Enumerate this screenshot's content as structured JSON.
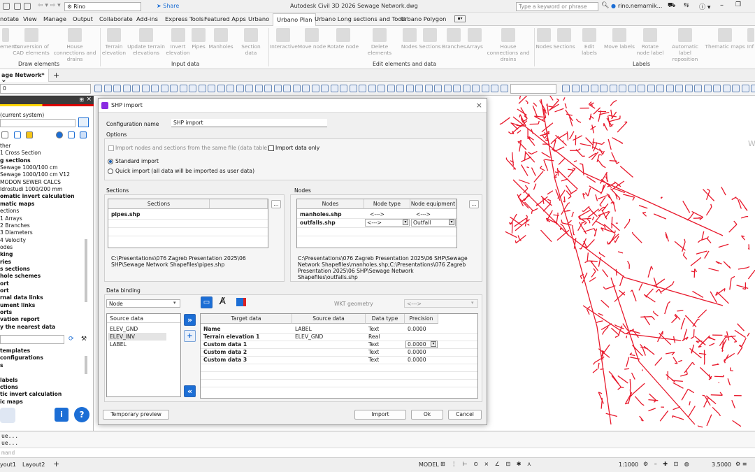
{
  "app": {
    "title": "Autodesk Civil 3D 2026   Sewage Network.dwg",
    "workspace": "Rino",
    "share": "Share",
    "search_placeholder": "Type a keyword or phrase",
    "user": "rino.nemarnik..."
  },
  "ribbon_tabs": [
    "notate",
    "View",
    "Manage",
    "Output",
    "Collaborate",
    "Add-ins",
    "Express Tools",
    "Featured Apps",
    "Urbano",
    "Urbano Plan",
    "Urbano Long sections and Tools",
    "Urbano Polygon"
  ],
  "ribbon": {
    "draw": [
      {
        "label": "ements"
      },
      {
        "label": "Conversion of CAD elements"
      },
      {
        "label": "House connections and drains"
      }
    ],
    "input": [
      {
        "label": "Terrain elevation"
      },
      {
        "label": "Update terrain elevations"
      },
      {
        "label": "Invert elevation"
      },
      {
        "label": "Pipes"
      },
      {
        "label": "Manholes"
      },
      {
        "label": "Section data"
      }
    ],
    "edit": [
      {
        "label": "Interactive"
      },
      {
        "label": "Move node"
      },
      {
        "label": "Rotate node"
      },
      {
        "label": "Delete elements"
      },
      {
        "label": "Nodes"
      },
      {
        "label": "Sections"
      },
      {
        "label": "Branches"
      },
      {
        "label": "Arrays"
      },
      {
        "label": "House connections and drains"
      }
    ],
    "labels": [
      {
        "label": "Nodes"
      },
      {
        "label": "Sections"
      },
      {
        "label": "Edit labels"
      },
      {
        "label": "Move labels"
      },
      {
        "label": "Rotate node label"
      },
      {
        "label": "Automatic label reposition"
      },
      {
        "label": "Thematic maps"
      },
      {
        "label": "Inf"
      }
    ],
    "groups": {
      "draw": "Draw elements",
      "input": "Input data",
      "edit": "Edit elements and data",
      "labels": "Labels"
    }
  },
  "doc_tab": "age Network*",
  "layer_value": "0",
  "left_panel": {
    "header": "(current system)",
    "tree": [
      {
        "t": "ther",
        "b": false
      },
      {
        "t": "1 Cross Section",
        "b": false
      },
      {
        "t": "g sections",
        "b": true
      },
      {
        "t": "Sewage 1000/100 cm",
        "b": false
      },
      {
        "t": "Sewage 1000/100 cm V12",
        "b": false
      },
      {
        "t": "MODON SEWER CALCS",
        "b": false
      },
      {
        "t": "Idrostudi 1000/200 mm",
        "b": false
      },
      {
        "t": "omatic invert calculation",
        "b": true
      },
      {
        "t": "matic maps",
        "b": true
      },
      {
        "t": "ections",
        "b": false
      },
      {
        "t": "1 Arrays",
        "b": false
      },
      {
        "t": "2 Branches",
        "b": false
      },
      {
        "t": "3 Diameters",
        "b": false
      },
      {
        "t": "4 Velocity",
        "b": false
      },
      {
        "t": "odes",
        "b": false
      },
      {
        "t": "king",
        "b": true
      },
      {
        "t": "ries",
        "b": true
      },
      {
        "t": "s sections",
        "b": true
      },
      {
        "t": "hole schemes",
        "b": true
      },
      {
        "t": "ort",
        "b": true
      },
      {
        "t": "ort",
        "b": true
      },
      {
        "t": "rnal data links",
        "b": true
      },
      {
        "t": "ument links",
        "b": true
      },
      {
        "t": "orts",
        "b": true
      },
      {
        "t": "vation report",
        "b": true
      },
      {
        "t": "y the nearest data",
        "b": true
      }
    ],
    "tree2": [
      {
        "t": " templates",
        "b": true
      },
      {
        "t": "configurations",
        "b": true
      },
      {
        "t": "s",
        "b": true
      },
      {
        "t": "",
        "b": false
      },
      {
        "t": " labels",
        "b": true
      },
      {
        "t": "ctions",
        "b": true
      },
      {
        "t": "tic invert calculation",
        "b": true
      },
      {
        "t": "ic maps",
        "b": true
      }
    ]
  },
  "dialog": {
    "title": "SHP import",
    "config_label": "Configuration name",
    "config_value": "SHP import",
    "options_label": "Options",
    "opt_same_file": "Import nodes and sections from the same file (data table)",
    "opt_import_data_only": "Import data only",
    "opt_standard": "Standard import",
    "opt_quick": "Quick import (all data will be imported as user data)",
    "sections_label": "Sections",
    "sections_header": "Sections",
    "sections_rows": [
      "pipes.shp"
    ],
    "sections_path": "C:\\Presentations\\076 Zagreb Presentation 2025\\06 SHP\\Sewage Network Shapefiles\\pipes.shp",
    "nodes_label": "Nodes",
    "nodes_headers": [
      "Nodes",
      "Node type",
      "Node equipment"
    ],
    "nodes_rows": [
      [
        "manholes.shp",
        "<--->",
        "<--->"
      ],
      [
        "outfalls.shp",
        "<--->",
        "Outfall"
      ]
    ],
    "nodes_path": "C:\\Presentations\\076 Zagreb Presentation 2025\\06 SHP\\Sewage Network Shapefiles\\manholes.shp;C:\\Presentations\\076 Zagreb Presentation 2025\\06 SHP\\Sewage Network Shapefiles\\outfalls.shp",
    "binding_label": "Data binding",
    "binding_select": "Node",
    "wkt_label": "WKT geometry",
    "wkt_value": "<--->",
    "source_header": "Source data",
    "source_items": [
      "ELEV_GND",
      "ELEV_INV",
      "LABEL"
    ],
    "bind_headers": [
      "Target data",
      "Source data",
      "Data type",
      "Precision"
    ],
    "bind_rows": [
      [
        "Name",
        "LABEL",
        "Text",
        "0.0000"
      ],
      [
        "Terrain elevation 1",
        "ELEV_GND",
        "Real",
        ""
      ],
      [
        "Custom data 1",
        "",
        "Text",
        "0.0000"
      ],
      [
        "Custom data 2",
        "",
        "Text",
        "0.0000"
      ],
      [
        "Custom data 3",
        "",
        "Text",
        "0.0000"
      ]
    ],
    "btn_preview": "Temporary preview",
    "btn_import": "Import",
    "btn_ok": "Ok",
    "btn_cancel": "Cancel",
    "ellipsis": "..."
  },
  "command": {
    "lines": [
      "ue...",
      "ue..."
    ],
    "prompt": "mand"
  },
  "status": {
    "layout1": "yout1",
    "layout2": "Layout2",
    "model": "MODEL",
    "scale": "1:1000",
    "value": "3.5000"
  },
  "canvas": {
    "watermark": "W"
  },
  "colors": {
    "network": "#e8192c",
    "accent": "#1c6ed5"
  }
}
